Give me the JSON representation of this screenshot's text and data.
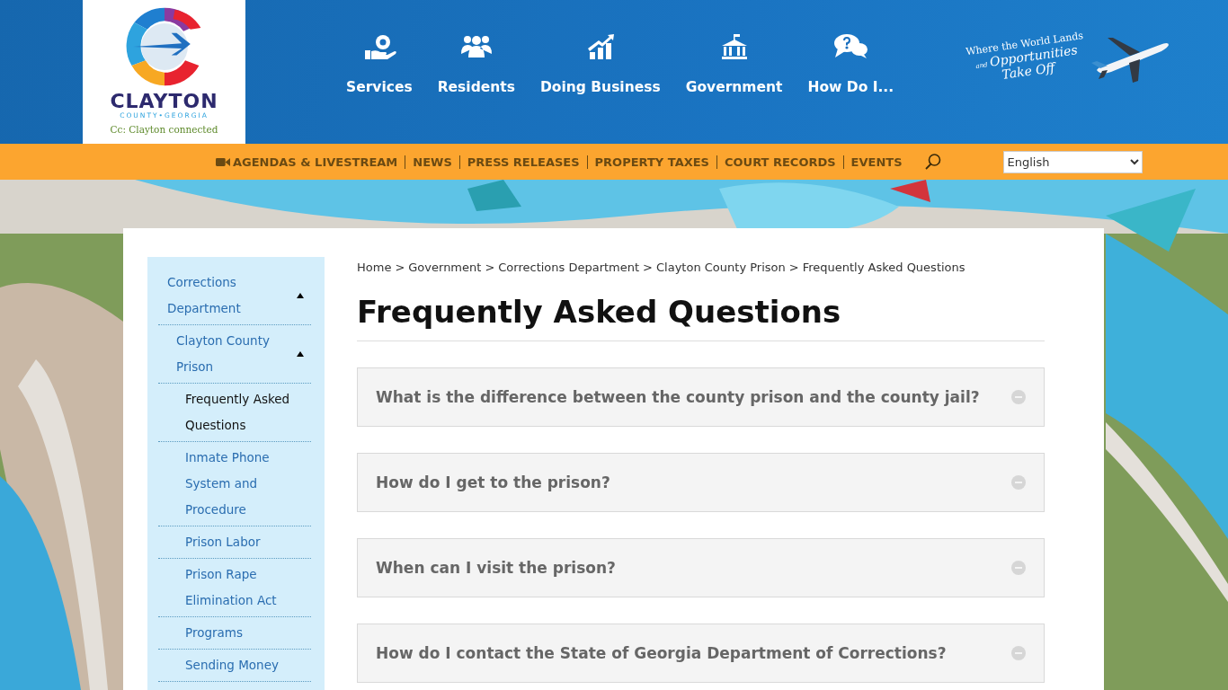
{
  "logo": {
    "name": "CLAYTON",
    "subtitle": "COUNTY•GEORGIA",
    "slogan": "Cc: Clayton connected"
  },
  "main_nav": [
    {
      "label": "Services"
    },
    {
      "label": "Residents"
    },
    {
      "label": "Doing Business"
    },
    {
      "label": "Government"
    },
    {
      "label": "How Do I..."
    }
  ],
  "tagline": {
    "line_1": "Where the World Lands",
    "small": "and",
    "line_2": "Opportunities",
    "line_3": "Take Off"
  },
  "utility_nav": [
    {
      "label": "AGENDAS & LIVESTREAM"
    },
    {
      "label": "NEWS"
    },
    {
      "label": "PRESS RELEASES"
    },
    {
      "label": "PROPERTY TAXES"
    },
    {
      "label": "COURT RECORDS"
    },
    {
      "label": "EVENTS"
    }
  ],
  "language_select": {
    "value": "English"
  },
  "sidebar": {
    "items": [
      {
        "label": "Corrections Department",
        "expanded": true,
        "selected": false,
        "children": [
          {
            "label": "Clayton County Prison",
            "expanded": true,
            "selected": false,
            "children": [
              {
                "label": "Frequently Asked Questions",
                "selected": true
              },
              {
                "label": "Inmate Phone System and Procedure",
                "selected": false
              },
              {
                "label": "Prison Labor",
                "selected": false
              },
              {
                "label": "Prison Rape Elimination Act",
                "selected": false
              },
              {
                "label": "Programs",
                "selected": false
              },
              {
                "label": "Sending Money",
                "selected": false
              }
            ]
          }
        ]
      }
    ]
  },
  "breadcrumb": {
    "separator": ">",
    "items": [
      "Home",
      "Government",
      "Corrections Department",
      "Clayton County Prison",
      "Frequently Asked Questions"
    ]
  },
  "page_title": "Frequently Asked Questions",
  "faq": [
    {
      "question": "What is the difference between the county prison and the county jail?",
      "expanded": false
    },
    {
      "question": "How do I get to the prison?",
      "expanded": false
    },
    {
      "question": "When can I visit the prison?",
      "expanded": false
    },
    {
      "question": "How do I contact the State of Georgia Department of Corrections?",
      "expanded": false
    }
  ]
}
